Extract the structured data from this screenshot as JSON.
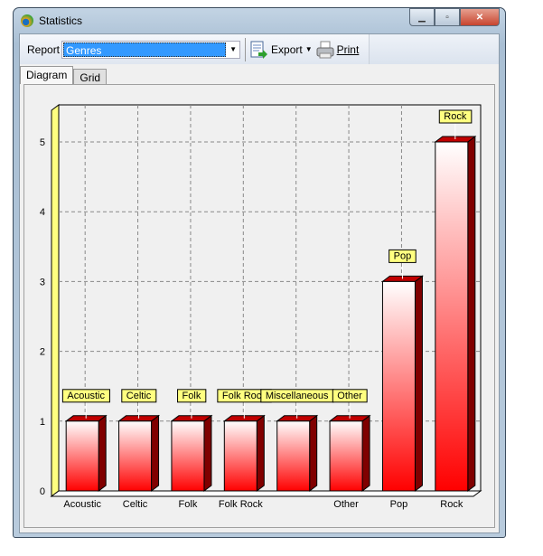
{
  "window": {
    "title": "Statistics",
    "icon": "app-disc-icon"
  },
  "toolbar": {
    "report_label": "Report",
    "report_value": "Genres",
    "export_label": "Export",
    "print_label": "Print"
  },
  "tabs": [
    {
      "label": "Diagram",
      "active": true
    },
    {
      "label": "Grid",
      "active": false
    }
  ],
  "chart_data": {
    "type": "bar",
    "categories": [
      "Acoustic",
      "Celtic",
      "Folk",
      "Folk Rock",
      "Miscellaneous",
      "Other",
      "Pop",
      "Rock"
    ],
    "xtick_labels": [
      "Acoustic",
      "Celtic",
      "Folk",
      "Folk Rock",
      "",
      "Other",
      "Pop",
      "Rock"
    ],
    "values": [
      1,
      1,
      1,
      1,
      1,
      1,
      3,
      5
    ],
    "data_labels": [
      "Acoustic",
      "Celtic",
      "Folk",
      "Folk Rock",
      "Miscellaneous",
      "Other",
      "Pop",
      "Rock"
    ],
    "yticks": [
      "0",
      "1",
      "2",
      "3",
      "4",
      "5"
    ],
    "ylim": [
      0,
      5.6
    ],
    "grid": true,
    "style": "3d",
    "colors": {
      "bar_top": "#ffffff",
      "bar_bottom": "#ff0000",
      "bar_side": "#800000",
      "bar_cap": "#c00000",
      "label_bg": "#ffff80",
      "wall": "#ffff80"
    }
  }
}
